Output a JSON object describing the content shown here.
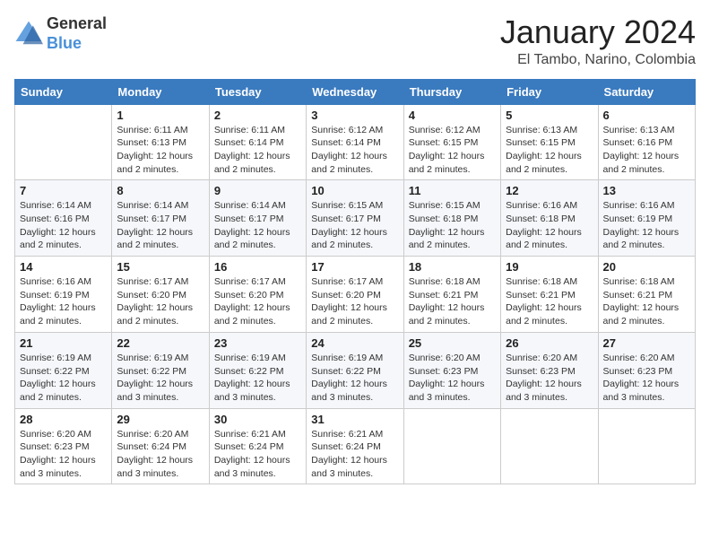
{
  "logo": {
    "text_general": "General",
    "text_blue": "Blue"
  },
  "header": {
    "month_year": "January 2024",
    "location": "El Tambo, Narino, Colombia"
  },
  "days_of_week": [
    "Sunday",
    "Monday",
    "Tuesday",
    "Wednesday",
    "Thursday",
    "Friday",
    "Saturday"
  ],
  "weeks": [
    [
      {
        "day": "",
        "info": ""
      },
      {
        "day": "1",
        "info": "Sunrise: 6:11 AM\nSunset: 6:13 PM\nDaylight: 12 hours\nand 2 minutes."
      },
      {
        "day": "2",
        "info": "Sunrise: 6:11 AM\nSunset: 6:14 PM\nDaylight: 12 hours\nand 2 minutes."
      },
      {
        "day": "3",
        "info": "Sunrise: 6:12 AM\nSunset: 6:14 PM\nDaylight: 12 hours\nand 2 minutes."
      },
      {
        "day": "4",
        "info": "Sunrise: 6:12 AM\nSunset: 6:15 PM\nDaylight: 12 hours\nand 2 minutes."
      },
      {
        "day": "5",
        "info": "Sunrise: 6:13 AM\nSunset: 6:15 PM\nDaylight: 12 hours\nand 2 minutes."
      },
      {
        "day": "6",
        "info": "Sunrise: 6:13 AM\nSunset: 6:16 PM\nDaylight: 12 hours\nand 2 minutes."
      }
    ],
    [
      {
        "day": "7",
        "info": "Sunrise: 6:14 AM\nSunset: 6:16 PM\nDaylight: 12 hours\nand 2 minutes."
      },
      {
        "day": "8",
        "info": "Sunrise: 6:14 AM\nSunset: 6:17 PM\nDaylight: 12 hours\nand 2 minutes."
      },
      {
        "day": "9",
        "info": "Sunrise: 6:14 AM\nSunset: 6:17 PM\nDaylight: 12 hours\nand 2 minutes."
      },
      {
        "day": "10",
        "info": "Sunrise: 6:15 AM\nSunset: 6:17 PM\nDaylight: 12 hours\nand 2 minutes."
      },
      {
        "day": "11",
        "info": "Sunrise: 6:15 AM\nSunset: 6:18 PM\nDaylight: 12 hours\nand 2 minutes."
      },
      {
        "day": "12",
        "info": "Sunrise: 6:16 AM\nSunset: 6:18 PM\nDaylight: 12 hours\nand 2 minutes."
      },
      {
        "day": "13",
        "info": "Sunrise: 6:16 AM\nSunset: 6:19 PM\nDaylight: 12 hours\nand 2 minutes."
      }
    ],
    [
      {
        "day": "14",
        "info": "Sunrise: 6:16 AM\nSunset: 6:19 PM\nDaylight: 12 hours\nand 2 minutes."
      },
      {
        "day": "15",
        "info": "Sunrise: 6:17 AM\nSunset: 6:20 PM\nDaylight: 12 hours\nand 2 minutes."
      },
      {
        "day": "16",
        "info": "Sunrise: 6:17 AM\nSunset: 6:20 PM\nDaylight: 12 hours\nand 2 minutes."
      },
      {
        "day": "17",
        "info": "Sunrise: 6:17 AM\nSunset: 6:20 PM\nDaylight: 12 hours\nand 2 minutes."
      },
      {
        "day": "18",
        "info": "Sunrise: 6:18 AM\nSunset: 6:21 PM\nDaylight: 12 hours\nand 2 minutes."
      },
      {
        "day": "19",
        "info": "Sunrise: 6:18 AM\nSunset: 6:21 PM\nDaylight: 12 hours\nand 2 minutes."
      },
      {
        "day": "20",
        "info": "Sunrise: 6:18 AM\nSunset: 6:21 PM\nDaylight: 12 hours\nand 2 minutes."
      }
    ],
    [
      {
        "day": "21",
        "info": "Sunrise: 6:19 AM\nSunset: 6:22 PM\nDaylight: 12 hours\nand 2 minutes."
      },
      {
        "day": "22",
        "info": "Sunrise: 6:19 AM\nSunset: 6:22 PM\nDaylight: 12 hours\nand 3 minutes."
      },
      {
        "day": "23",
        "info": "Sunrise: 6:19 AM\nSunset: 6:22 PM\nDaylight: 12 hours\nand 3 minutes."
      },
      {
        "day": "24",
        "info": "Sunrise: 6:19 AM\nSunset: 6:22 PM\nDaylight: 12 hours\nand 3 minutes."
      },
      {
        "day": "25",
        "info": "Sunrise: 6:20 AM\nSunset: 6:23 PM\nDaylight: 12 hours\nand 3 minutes."
      },
      {
        "day": "26",
        "info": "Sunrise: 6:20 AM\nSunset: 6:23 PM\nDaylight: 12 hours\nand 3 minutes."
      },
      {
        "day": "27",
        "info": "Sunrise: 6:20 AM\nSunset: 6:23 PM\nDaylight: 12 hours\nand 3 minutes."
      }
    ],
    [
      {
        "day": "28",
        "info": "Sunrise: 6:20 AM\nSunset: 6:23 PM\nDaylight: 12 hours\nand 3 minutes."
      },
      {
        "day": "29",
        "info": "Sunrise: 6:20 AM\nSunset: 6:24 PM\nDaylight: 12 hours\nand 3 minutes."
      },
      {
        "day": "30",
        "info": "Sunrise: 6:21 AM\nSunset: 6:24 PM\nDaylight: 12 hours\nand 3 minutes."
      },
      {
        "day": "31",
        "info": "Sunrise: 6:21 AM\nSunset: 6:24 PM\nDaylight: 12 hours\nand 3 minutes."
      },
      {
        "day": "",
        "info": ""
      },
      {
        "day": "",
        "info": ""
      },
      {
        "day": "",
        "info": ""
      }
    ]
  ]
}
